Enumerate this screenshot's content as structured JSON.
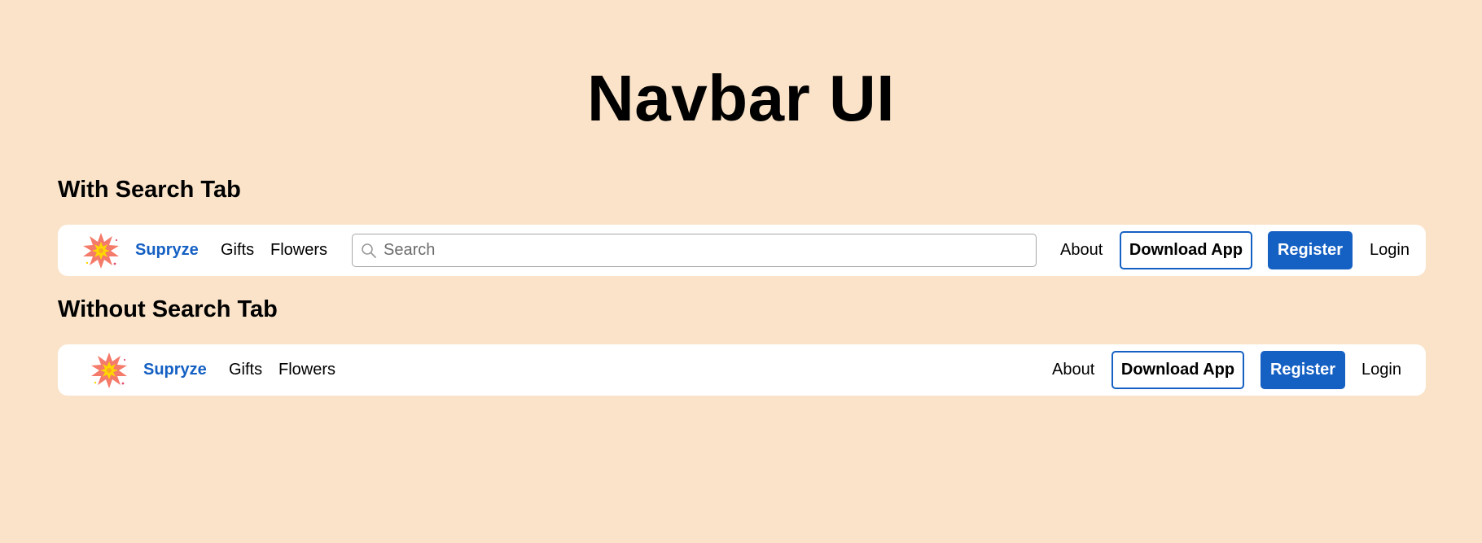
{
  "page": {
    "title": "Navbar UI"
  },
  "sections": {
    "with_search": {
      "heading": "With Search Tab",
      "brand": "Supryze",
      "links": [
        "Gifts",
        "Flowers"
      ],
      "search": {
        "placeholder": "Search",
        "value": ""
      },
      "about": "About",
      "download": "Download App",
      "register": "Register",
      "login": "Login"
    },
    "without_search": {
      "heading": "Without Search Tab",
      "brand": "Supryze",
      "links": [
        "Gifts",
        "Flowers"
      ],
      "about": "About",
      "download": "Download App",
      "register": "Register",
      "login": "Login"
    }
  },
  "colors": {
    "page_background": "#fae3c9",
    "navbar_background": "#ffffff",
    "accent": "#1560c3",
    "logo_burst": "#f47a6a",
    "logo_center": "#ffd700"
  },
  "icons": {
    "logo": "starburst-logo-icon",
    "search": "search-icon"
  }
}
